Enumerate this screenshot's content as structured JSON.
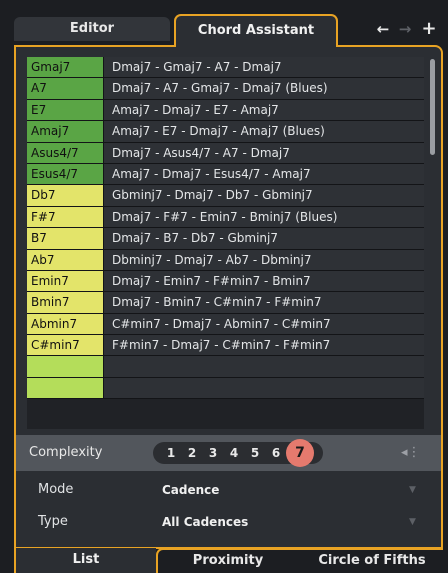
{
  "tabs": {
    "editor": "Editor",
    "chord_assistant": "Chord Assistant",
    "back_icon": "←",
    "forward_icon": "→",
    "add_icon": "+"
  },
  "rows": [
    {
      "chord": "Gmaj7",
      "progression": "Dmaj7 - Gmaj7 - A7 - Dmaj7",
      "color": "green"
    },
    {
      "chord": "A7",
      "progression": "Dmaj7 - A7 - Gmaj7 - Dmaj7 (Blues)",
      "color": "green"
    },
    {
      "chord": "E7",
      "progression": "Amaj7 - Dmaj7 - E7 - Amaj7",
      "color": "green"
    },
    {
      "chord": "Amaj7",
      "progression": "Amaj7 - E7 - Dmaj7 - Amaj7 (Blues)",
      "color": "green"
    },
    {
      "chord": "Asus4/7",
      "progression": "Dmaj7 - Asus4/7 - A7 - Dmaj7",
      "color": "green"
    },
    {
      "chord": "Esus4/7",
      "progression": "Amaj7 - Dmaj7 - Esus4/7 - Amaj7",
      "color": "green"
    },
    {
      "chord": "Db7",
      "progression": "Gbminj7 - Dmaj7 - Db7 - Gbminj7",
      "color": "yellow"
    },
    {
      "chord": "F#7",
      "progression": "Dmaj7 - F#7 - Emin7 - Bminj7 (Blues)",
      "color": "yellow"
    },
    {
      "chord": "B7",
      "progression": "Dmaj7 - B7 - Db7 - Gbminj7",
      "color": "yellow"
    },
    {
      "chord": "Ab7",
      "progression": "Dbminj7 - Dmaj7 - Ab7 - Dbminj7",
      "color": "yellow"
    },
    {
      "chord": "Emin7",
      "progression": "Dmaj7 - Emin7 - F#min7 - Bmin7",
      "color": "yellow"
    },
    {
      "chord": "Bmin7",
      "progression": "Dmaj7 - Bmin7 - C#min7 - F#min7",
      "color": "yellow"
    },
    {
      "chord": "Abmin7",
      "progression": "C#min7 - Dmaj7 - Abmin7 - C#min7",
      "color": "yellow"
    },
    {
      "chord": "C#min7",
      "progression": "F#min7 - Dmaj7 - C#min7 - F#min7",
      "color": "yellow"
    },
    {
      "chord": "",
      "progression": "",
      "color": "lime"
    },
    {
      "chord": "",
      "progression": "",
      "color": "lime"
    }
  ],
  "complexity": {
    "label": "Complexity",
    "levels": [
      "1",
      "2",
      "3",
      "4",
      "5",
      "6"
    ],
    "selected": "7",
    "icon": "more-options-icon"
  },
  "mode": {
    "label": "Mode",
    "value": "Cadence"
  },
  "type": {
    "label": "Type",
    "value": "All Cadences"
  },
  "bottom_tabs": {
    "list": "List",
    "proximity": "Proximity",
    "circle": "Circle of Fifths"
  },
  "colors": {
    "accent": "#e8a324",
    "green": "#5aa545",
    "yellow": "#e3e46a",
    "selected_complexity": "#e57a6e"
  }
}
